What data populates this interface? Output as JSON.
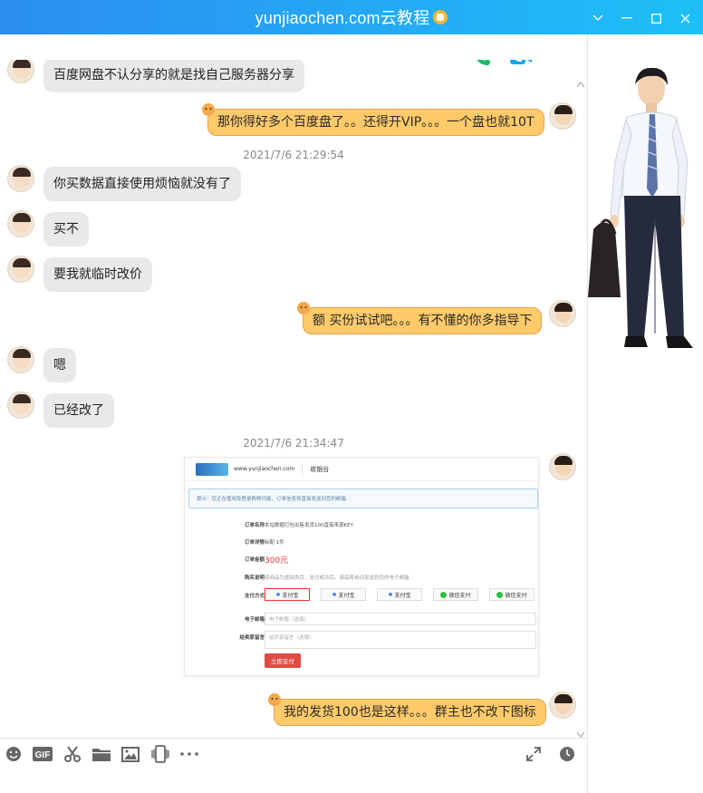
{
  "window": {
    "title": "yunjiaochen.com云教程",
    "badge_icon": "vip-badge-icon",
    "accent_gradient": [
      "#2b8ef0",
      "#1ec0f8"
    ]
  },
  "toolbar": {
    "items": [
      "voice-call-icon",
      "video-call-icon",
      "more-icon"
    ]
  },
  "messages": [
    {
      "side": "left",
      "text": "百度网盘不认分享的就是找自己服务器分享"
    },
    {
      "side": "right",
      "text": "那你得好多个百度盘了。。还得开VIP。。。一个盘也就10T"
    },
    {
      "type": "time",
      "text": "2021/7/6 21:29:54"
    },
    {
      "side": "left",
      "text": "你买数据直接使用烦恼就没有了"
    },
    {
      "side": "left",
      "text": "买不"
    },
    {
      "side": "left",
      "text": "要我就临时改价"
    },
    {
      "side": "right",
      "text": "额 买份试试吧。。。有不懂的你多指导下"
    },
    {
      "side": "left",
      "text": "嗯"
    },
    {
      "side": "left",
      "text": "已经改了"
    },
    {
      "type": "time",
      "text": "2021/7/6 21:34:47"
    },
    {
      "side": "right",
      "text": "我的发货100也是这样。。。群主也不改下图标"
    }
  ],
  "shared_image": {
    "header_label": "收银台",
    "logo_text": "www.yunjiaochen.com",
    "tip": "提示：您正在使用免登录购物功能，订单信息将直接发送到您的邮箱",
    "rows": {
      "order_name_label": "订单名称",
      "order_name_value": "本站数据打包出售发货100直接来源KEY",
      "order_detail_label": "订单详情",
      "order_detail_value": "标配 1件",
      "order_amount_label": "订单金额",
      "order_amount_value": "300元",
      "purchase_note_label": "购买说明",
      "purchase_note_value": "该商品为虚拟类目，支付成功后，商品将自动发送到您的电子邮箱",
      "payment_label": "支付方式",
      "email_label": "电子邮箱",
      "email_placeholder": "电子邮箱（选填）",
      "message_label": "给卖家留言",
      "message_placeholder": "给卖家留言（选填）"
    },
    "pay_options": [
      "支付宝",
      "支付宝",
      "支付宝",
      "微信支付",
      "微信支付"
    ],
    "pay_button": "立即支付"
  },
  "input_toolbar": {
    "left": [
      "emoji-icon",
      "gif-icon",
      "scissors-icon",
      "folder-icon",
      "image-icon",
      "phone-shake-icon",
      "more-icon"
    ],
    "right": [
      "expand-icon",
      "history-clock-icon"
    ]
  }
}
